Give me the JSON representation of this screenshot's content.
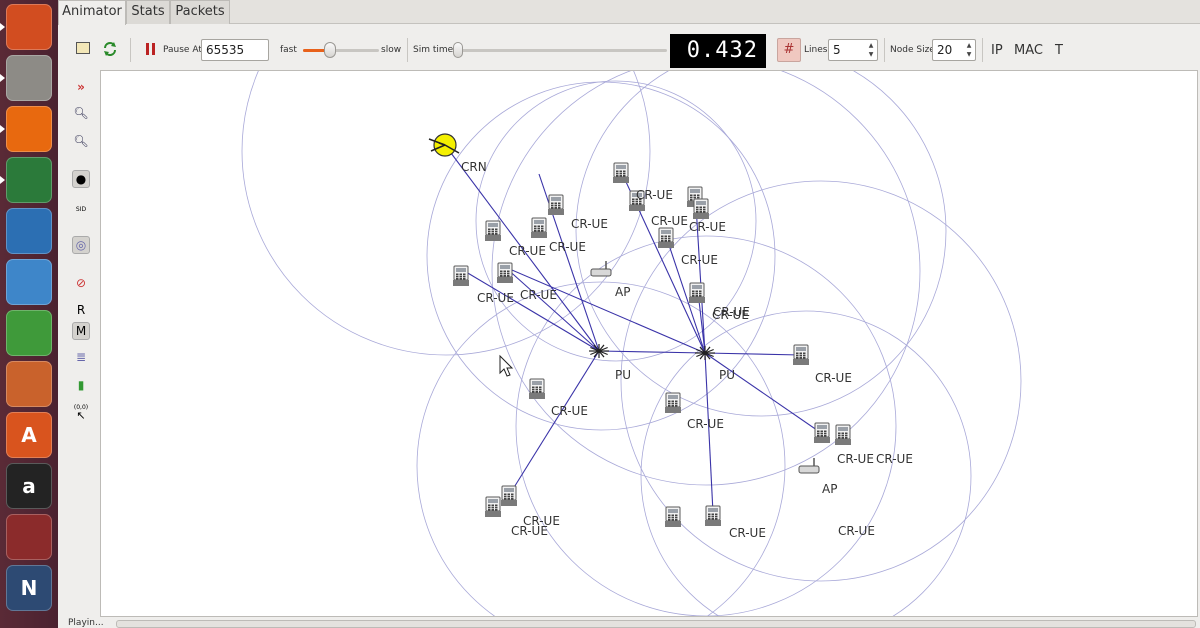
{
  "launcher": {
    "items": [
      {
        "name": "ubuntu-dash-icon",
        "glyph": "",
        "color": "#d24d20"
      },
      {
        "name": "file-cabinet-icon",
        "glyph": "",
        "color": "#8d8b86"
      },
      {
        "name": "firefox-icon",
        "glyph": "",
        "color": "#e8690f"
      },
      {
        "name": "globe-app-icon",
        "glyph": "",
        "color": "#2b7a3a"
      },
      {
        "name": "writer-document-icon",
        "glyph": "",
        "color": "#2c6fb3"
      },
      {
        "name": "cube-3d-icon",
        "glyph": "",
        "color": "#3e86c9"
      },
      {
        "name": "calc-spreadsheet-icon",
        "glyph": "",
        "color": "#3f9a3a"
      },
      {
        "name": "impress-presentation-icon",
        "glyph": "",
        "color": "#c9622c"
      },
      {
        "name": "software-center-icon",
        "glyph": "A",
        "color": "#d9541e"
      },
      {
        "name": "amazon-icon",
        "glyph": "a",
        "color": "#232323"
      },
      {
        "name": "system-settings-icon",
        "glyph": "",
        "color": "#8b2b2b"
      },
      {
        "name": "netanim-icon",
        "glyph": "N",
        "color": "#2d4a73"
      }
    ]
  },
  "tabs": [
    {
      "label": "Animator"
    },
    {
      "label": "Stats"
    },
    {
      "label": "Packets"
    }
  ],
  "toolbar": {
    "pause_at_label": "Pause At",
    "pause_at_value": "65535",
    "fast_label": "fast",
    "slow_label": "slow",
    "speed_fraction": 0.35,
    "sim_time_label": "Sim time",
    "sim_time_fraction": 0.0,
    "lcd_value": "0.432",
    "lines_label": "Lines",
    "lines_value": "5",
    "node_size_label": "Node Size",
    "node_size_value": "20",
    "ip_label": "IP",
    "mac_label": "MAC",
    "t_label": "T"
  },
  "sidetools": {
    "r_label": "R",
    "m_label": "M",
    "sid_label": "SID",
    "coord_label": "(0,0)"
  },
  "statusbar": {
    "text": "Playin..."
  },
  "network": {
    "labels": {
      "crn": "CRN",
      "cr_ue": "CR-UE",
      "pu": "PU",
      "ap": "AP"
    }
  },
  "colors": {
    "link": "#3a33a8",
    "range_circle": "#a8a8d8",
    "crn_node": "#f4f000",
    "lcd_bg": "#000000",
    "lcd_fg": "#ffffff",
    "launcher_bg": "#4a2230"
  }
}
